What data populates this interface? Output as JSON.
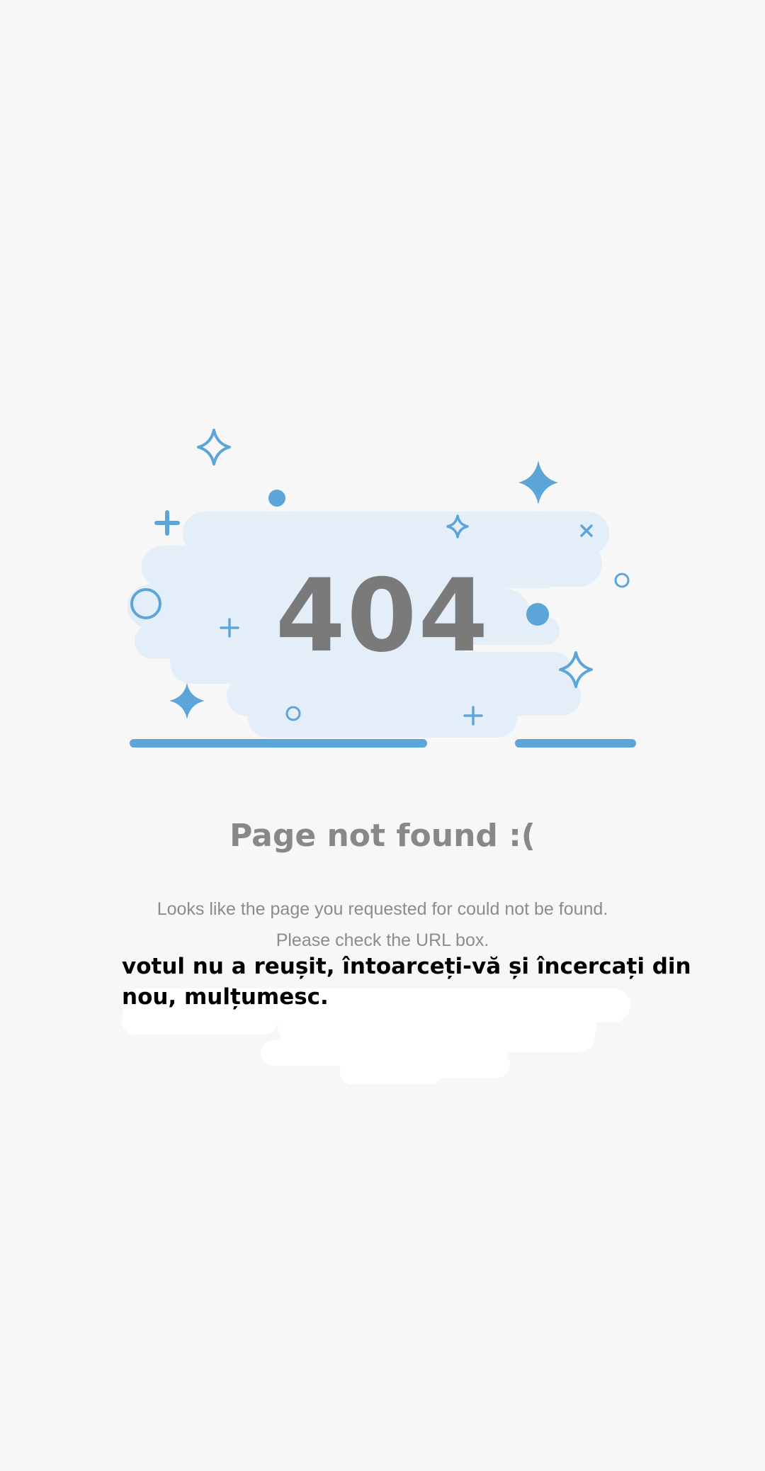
{
  "error_page": {
    "code": "404",
    "title": "Page not found :(",
    "message_line1": "Looks like the page you requested for could not be found.",
    "message_line2": "Please check the URL box."
  },
  "overlay_note": {
    "text": "votul nu a reușit, întoarceți-vă și încercați din nou, mulțumesc."
  },
  "colors": {
    "background": "#f7f7f7",
    "cloud": "#e3eef9",
    "accent_blue": "#5ca5d8",
    "code_gray": "#7a7a7a",
    "text_gray": "#888888",
    "overlay_text": "#000000"
  },
  "icons": [
    "sparkle-outline-icon",
    "sparkle-filled-icon",
    "plus-icon",
    "dot-icon",
    "ring-icon",
    "cross-icon"
  ]
}
